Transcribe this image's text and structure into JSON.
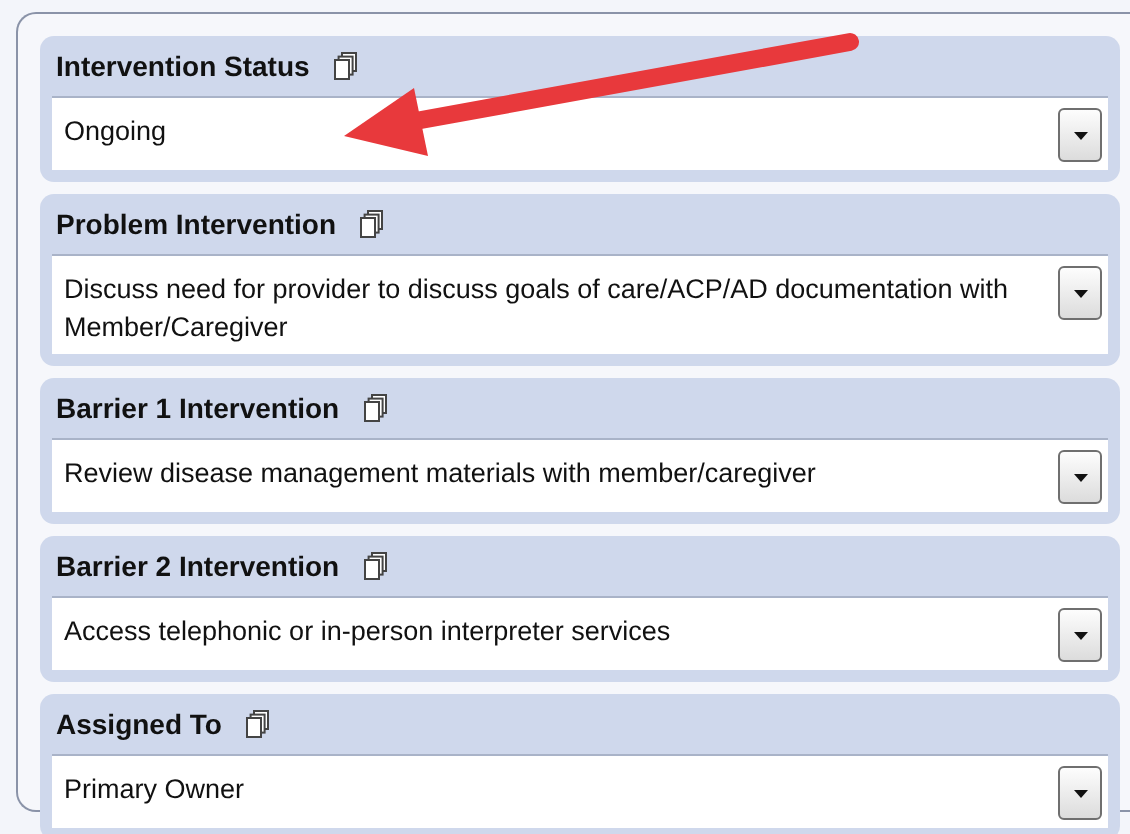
{
  "sections": [
    {
      "label": "Intervention Status",
      "value": "Ongoing"
    },
    {
      "label": "Problem Intervention",
      "value": "Discuss need for provider to discuss goals of care/ACP/AD documentation with Member/Caregiver"
    },
    {
      "label": "Barrier 1 Intervention",
      "value": "Review disease management materials with member/caregiver"
    },
    {
      "label": "Barrier 2 Intervention",
      "value": "Access telephonic or in-person interpreter services"
    },
    {
      "label": "Assigned To",
      "value": "Primary Owner"
    }
  ]
}
